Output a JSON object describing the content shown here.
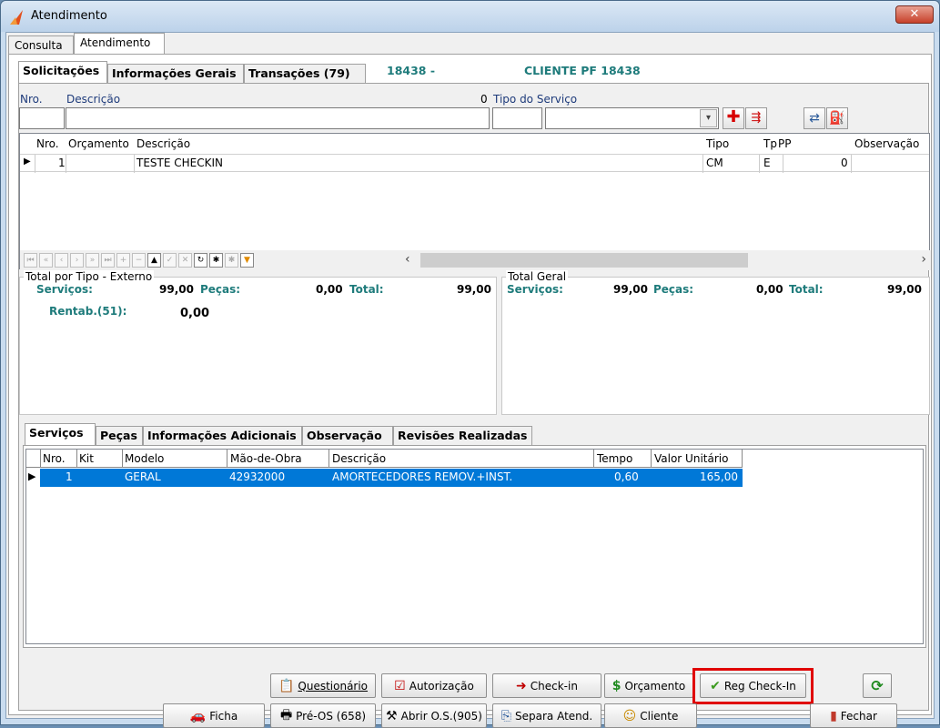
{
  "window": {
    "title": "Atendimento",
    "close_glyph": "✕"
  },
  "outer_tabs": [
    "Consulta",
    "Atendimento"
  ],
  "inner_tabs": [
    "Solicitações",
    "Informações Gerais",
    "Transações (79)"
  ],
  "header": {
    "code": "18438 -",
    "client": "CLIENTE PF 18438"
  },
  "form": {
    "nro_label": "Nro.",
    "descricao_label": "Descrição",
    "zero_value": "0",
    "tipo_servico_label": "Tipo do Serviço"
  },
  "requests_grid": {
    "columns": [
      "Nro.",
      "Orçamento",
      "Descrição",
      "Tipo",
      "Tp",
      "PP",
      "Observação"
    ],
    "rows": [
      {
        "nro": "1",
        "orcamento": "",
        "descricao": "TESTE CHECKIN",
        "tipo": "CM",
        "tp": "E",
        "pp": "0",
        "observacao": ""
      }
    ]
  },
  "total_tipo": {
    "title": "Total por Tipo - Externo",
    "servicos_label": "Serviços:",
    "servicos_value": "99,00",
    "pecas_label": "Peças:",
    "pecas_value": "0,00",
    "total_label": "Total:",
    "total_value": "99,00",
    "rentab_label": "Rentab.(51):",
    "rentab_value": "0,00"
  },
  "total_geral": {
    "title": "Total Geral",
    "servicos_label": "Serviços:",
    "servicos_value": "99,00",
    "pecas_label": "Peças:",
    "pecas_value": "0,00",
    "total_label": "Total:",
    "total_value": "99,00"
  },
  "service_tabs": [
    "Serviços",
    "Peças",
    "Informações Adicionais",
    "Observação",
    "Revisões Realizadas"
  ],
  "services_grid": {
    "columns": [
      "Nro.",
      "Kit",
      "Modelo",
      "Mão-de-Obra",
      "Descrição",
      "Tempo",
      "Valor Unitário"
    ],
    "rows": [
      {
        "nro": "1",
        "kit": "",
        "modelo": "GERAL",
        "mao_de_obra": "42932000",
        "descricao": "AMORTECEDORES REMOV.+INST.",
        "tempo": "0,60",
        "valor": "165,00"
      }
    ]
  },
  "buttons": {
    "questionario": "Questionário",
    "autorizacao": "Autorização",
    "checkin": "Check-in",
    "orcamento": "Orçamento",
    "reg_checkin": "Reg Check-In",
    "ficha": "Ficha",
    "pre_os": "Pré-OS (658)",
    "abrir_os": "Abrir O.S.(905)",
    "separa": "Separa Atend.",
    "cliente": "Cliente",
    "fechar": "Fechar"
  },
  "colors": {
    "accent_teal": "#1e7b7b",
    "selection": "#0078d7",
    "highlight": "#e00000"
  }
}
